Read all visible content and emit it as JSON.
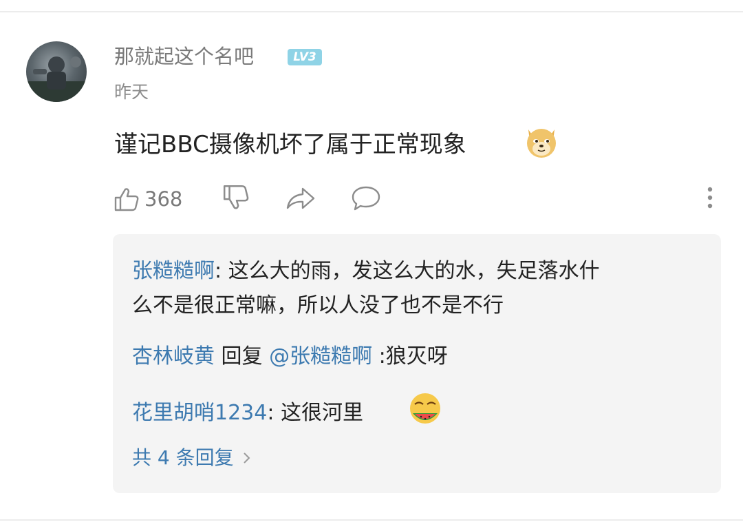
{
  "comment": {
    "username": "那就起这个名吧",
    "level": "LV3",
    "timestamp": "昨天",
    "text": "谨记BBC摄像机坏了属于正常现象",
    "emoji": "doge-emoji",
    "like_count": "368"
  },
  "replies": [
    {
      "user": "张糙糙啊",
      "sep": ": ",
      "text_line1": "这么大的雨，发这么大的水，失足落水什",
      "text_line2": "么不是很正常嘛，所以人没了也不是不行"
    },
    {
      "user": "杏林岐黄",
      "reply_word": " 回复 ",
      "target": "@张糙糙啊",
      "text": " :狼灭呀"
    },
    {
      "user": "花里胡哨1234",
      "sep": ": ",
      "text": "这很河里",
      "emoji": "watermelon-face-emoji"
    }
  ],
  "reply_summary": "共 4 条回复",
  "colors": {
    "link": "#3d7ab0",
    "badge": "#8fd3e6",
    "meta": "#8c8c8c"
  }
}
